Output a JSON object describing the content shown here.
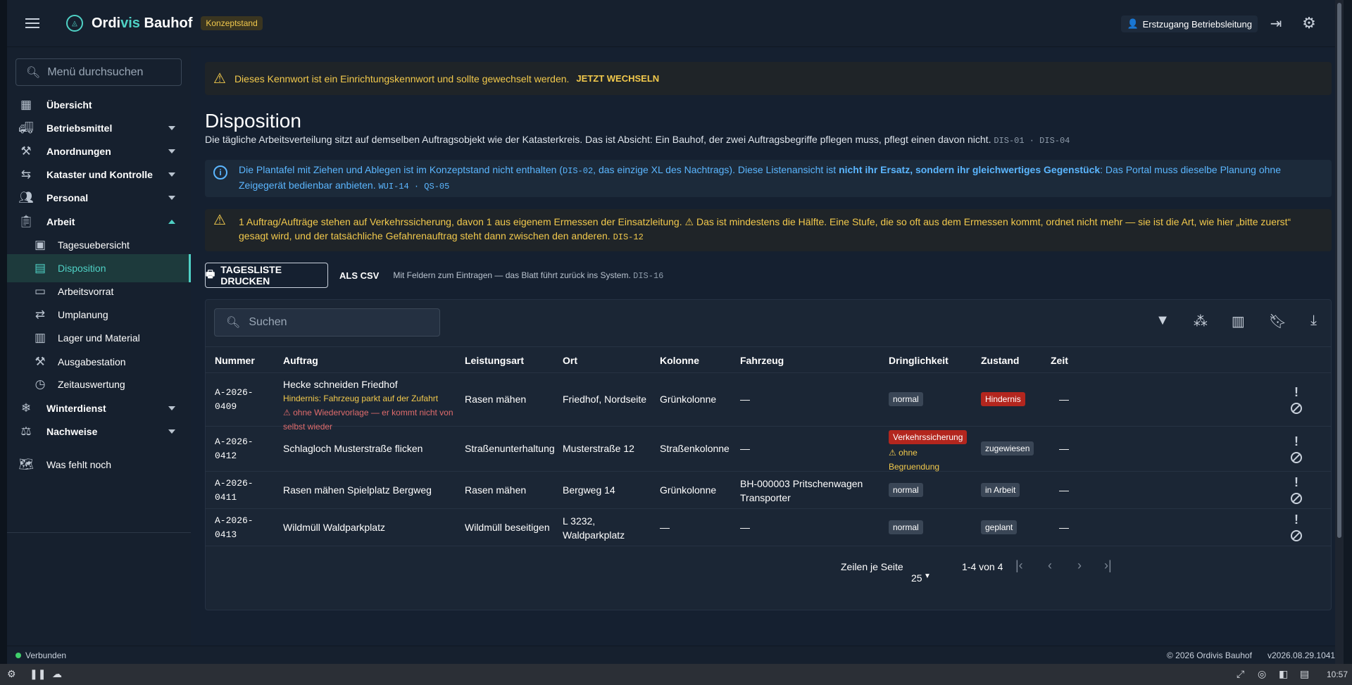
{
  "topbar": {
    "brand_a": "Ordi",
    "brand_b": "vis",
    "brand_c": " Bauhof",
    "badge": "Konzeptstand",
    "user": "Erstzugang Betriebsleitung"
  },
  "sidebar": {
    "search_placeholder": "Menü durchsuchen",
    "items": [
      {
        "label": "Übersicht"
      },
      {
        "label": "Betriebsmittel"
      },
      {
        "label": "Anordnungen"
      },
      {
        "label": "Kataster und Kontrolle"
      },
      {
        "label": "Personal"
      },
      {
        "label": "Arbeit"
      },
      {
        "label": "Tagesuebersicht"
      },
      {
        "label": "Disposition"
      },
      {
        "label": "Arbeitsvorrat"
      },
      {
        "label": "Umplanung"
      },
      {
        "label": "Lager und Material"
      },
      {
        "label": "Ausgabestation"
      },
      {
        "label": "Zeitauswertung"
      },
      {
        "label": "Winterdienst"
      },
      {
        "label": "Nachweise"
      },
      {
        "label": "Was fehlt noch"
      }
    ]
  },
  "banner1": {
    "text": "Dieses Kennwort ist ein Einrichtungskennwort und sollte gewechselt werden.",
    "link": "JETZT WECHSELN"
  },
  "page": {
    "title": "Disposition",
    "desc": "Die tägliche Arbeitsverteilung sitzt auf demselben Auftragsobjekt wie der Katasterkreis. Das ist Absicht: Ein Bauhof, der zwei Auftragsbegriffe pflegen muss, pflegt einen davon nicht.",
    "desc_code": "DIS-01 · DIS-04"
  },
  "info": {
    "t1": "Die Plantafel mit Ziehen und Ablegen ist im Konzeptstand nicht enthalten (",
    "code1": "DIS-02",
    "t2": ", das einzige XL des Nachtrags). Diese Listenansicht ist ",
    "bold": "nicht ihr Ersatz, sondern ihr gleichwertiges Gegenstück",
    "t3": ": Das Portal muss dieselbe Planung ohne Zeigegerät bedienbar anbieten.",
    "code2": "WUI-14 · QS-05"
  },
  "banner3": {
    "t1": "1 Auftrag/Aufträge stehen auf Verkehrssicherung, davon 1 aus eigenem Ermessen der Einsatzleitung.",
    "t2": "Das ist mindestens die Hälfte. Eine Stufe, die so oft aus dem Ermessen kommt, ordnet nicht mehr — sie ist die Art, wie hier „bitte zuerst“ gesagt wird, und der tatsächliche Gefahrenauftrag steht dann zwischen den anderen.",
    "code": "DIS-12"
  },
  "actions": {
    "print": "TAGESLISTE DRUCKEN",
    "csv": "ALS CSV",
    "note": "Mit Feldern zum Eintragen — das Blatt führt zurück ins System.",
    "code": "DIS-16"
  },
  "table": {
    "search_placeholder": "Suchen",
    "headers": [
      "Nummer",
      "Auftrag",
      "Leistungsart",
      "Ort",
      "Kolonne",
      "Fahrzeug",
      "Dringlichkeit",
      "Zustand",
      "Zeit"
    ],
    "rows": [
      {
        "num1": "A-2026-",
        "num2": "0409",
        "auftrag": "Hecke schneiden Friedhof",
        "sub1": "Hindernis: Fahrzeug parkt auf der Zufahrt",
        "sub2a": "⚠ ohne Wiedervorlage — er kommt nicht von",
        "sub2b": "selbst wieder",
        "leistung": "Rasen mähen",
        "ort": "Friedhof, Nordseite",
        "kolonne": "Grünkolonne",
        "fahrzeug": "—",
        "dring": "normal",
        "zustand": "Hindernis",
        "zeit": "—"
      },
      {
        "num1": "A-2026-",
        "num2": "0412",
        "auftrag": "Schlagloch Musterstraße flicken",
        "leistung": "Straßenunterhaltung",
        "ort": "Musterstraße 12",
        "kolonne": "Straßenkolonne",
        "fahrzeug": "—",
        "dring": "Verkehrssicherung",
        "warn1": "⚠ ohne",
        "warn2": "Begruendung",
        "zustand": "zugewiesen",
        "zeit": "—"
      },
      {
        "num1": "A-2026-",
        "num2": "0411",
        "auftrag": "Rasen mähen Spielplatz Bergweg",
        "leistung": "Rasen mähen",
        "ort": "Bergweg 14",
        "kolonne": "Grünkolonne",
        "fahrzeug1": "BH-000003 Pritschenwagen",
        "fahrzeug2": "Transporter",
        "dring": "normal",
        "zustand": "in Arbeit",
        "zeit": "—"
      },
      {
        "num1": "A-2026-",
        "num2": "0413",
        "auftrag": "Wildmüll Waldparkplatz",
        "leistung": "Wildmüll beseitigen",
        "ort1": "L 3232,",
        "ort2": "Waldparkplatz",
        "kolonne": "—",
        "fahrzeug": "—",
        "dring": "normal",
        "zustand": "geplant",
        "zeit": "—"
      }
    ],
    "pager": {
      "rows_label": "Zeilen je Seite",
      "rows_value": "25",
      "range": "1-4 von 4"
    }
  },
  "footer": {
    "status": "Verbunden",
    "copyright": "© 2026 Ordivis Bauhof",
    "version": "v2026.08.29.1041"
  },
  "taskbar": {
    "time": "10:57"
  },
  "colors": {
    "accent": "#4fd1c5",
    "warning": "#f2c94c",
    "info": "#5bb6ff",
    "danger": "#b3261e"
  }
}
